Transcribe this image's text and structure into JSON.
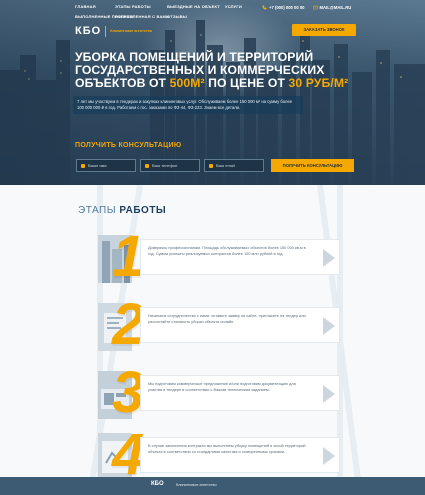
{
  "nav": {
    "items": [
      "ГЛАВНАЯ",
      "ЭТАПЫ РАБОТЫ",
      "ВЫЕЗДНЫЕ НА ОБЪЕКТ",
      "УСЛУГИ",
      "ВЫПОЛНЕННЫЕ ПРОЕКТЫ",
      "ОТПРАВЛЕННАЯ С ВАМИ",
      "ОТЗЫВЫ",
      ""
    ]
  },
  "contacts": {
    "phone": "+7 (000) 000 00 00",
    "email": "MAIL@MAIL.RU"
  },
  "logo": {
    "mark": "КБО",
    "tagline": "Клининговое агентство"
  },
  "header": {
    "callback_label": "ЗАКАЗАТЬ ЗВОНОК"
  },
  "hero": {
    "headline_line1": "Уборка помещений и территорий",
    "headline_line2": "государственных и коммерческих",
    "headline_line3_a": "объектов от ",
    "headline_line3_b": "500м²",
    "headline_line3_c": " по цене от ",
    "headline_line3_d": "30 руб/м²",
    "lead": "7 лет мы участвуем в тендерах и закупках клининговых услуг. Обслуживаем более 150 000 м² на сумму более 100 000 000 ₽ в год. Работаем с гос. заказами по ФЗ-44, ФЗ-223. Знаем все детали.",
    "consult_title": "ПОЛУЧИТЬ КОНСУЛЬТАЦИЮ"
  },
  "form": {
    "name_placeholder": "Ваше имя",
    "phone_placeholder": "Ваш телефон",
    "email_placeholder": "Ваш email",
    "submit_label": "ПОЛУЧИТЬ КОНСУЛЬТАЦИЮ"
  },
  "steps": {
    "title_light": "ЭТАПЫ",
    "title_bold": "РАБОТЫ",
    "items": [
      {
        "num": "1",
        "text": "Доверяясь профессионалам. Площадь обслуживаемых объектов более 150 000 кв.м в год. Сумма успешно реализуемых контрактов более 100 млн рублей в год."
      },
      {
        "num": "2",
        "text": "Начинаем сотрудничество с нами: оставьте заявку на сайте, пригласите на тендер или рассчитайте стоимость уборки объекта онлайн."
      },
      {
        "num": "3",
        "text": "Мы подготовим коммерческое предложение и/или подготовим документацию для участия в тендере в соответствии с Вашим техническим заданием."
      },
      {
        "num": "4",
        "text": "В случае заключения контракта мы выполняем уборку помещений и зоной территорий объекта в соответствии со стандартами качества и оговоренными сроками."
      }
    ]
  },
  "footer_band": {
    "logo": "КБО",
    "text": "Клининговое агентство"
  },
  "colors": {
    "accent": "#f5a800",
    "hero_dark": "#2c455c",
    "title_blue": "#1f3f5f"
  }
}
